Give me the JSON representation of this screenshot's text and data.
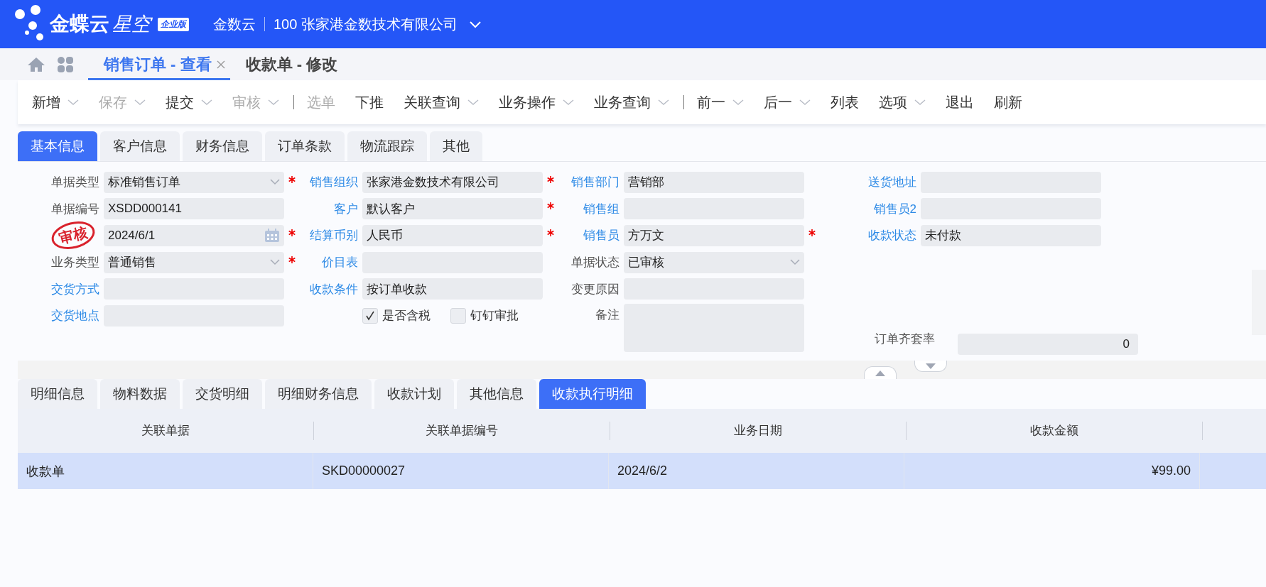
{
  "header": {
    "logo_main": "金蝶云",
    "logo_sub": "星空",
    "edition": "企业版",
    "tenant": "金数云",
    "company": "100 张家港金数技术有限公司"
  },
  "page_tabs": [
    {
      "label": "销售订单 - 查看",
      "selected": true,
      "closable": true
    },
    {
      "label": "收款单 - 修改",
      "selected": false,
      "closable": false
    }
  ],
  "toolbar": [
    {
      "kind": "button",
      "label": "新增",
      "dropdown": true,
      "disabled": false
    },
    {
      "kind": "button",
      "label": "保存",
      "dropdown": true,
      "disabled": true
    },
    {
      "kind": "button",
      "label": "提交",
      "dropdown": true,
      "disabled": false
    },
    {
      "kind": "button",
      "label": "审核",
      "dropdown": true,
      "disabled": true
    },
    {
      "kind": "separator"
    },
    {
      "kind": "button",
      "label": "选单",
      "dropdown": false,
      "disabled": true
    },
    {
      "kind": "button",
      "label": "下推",
      "dropdown": false,
      "disabled": false
    },
    {
      "kind": "button",
      "label": "关联查询",
      "dropdown": true,
      "disabled": false
    },
    {
      "kind": "button",
      "label": "业务操作",
      "dropdown": true,
      "disabled": false
    },
    {
      "kind": "button",
      "label": "业务查询",
      "dropdown": true,
      "disabled": false
    },
    {
      "kind": "separator"
    },
    {
      "kind": "button",
      "label": "前一",
      "dropdown": true,
      "disabled": false
    },
    {
      "kind": "button",
      "label": "后一",
      "dropdown": true,
      "disabled": false
    },
    {
      "kind": "button",
      "label": "列表",
      "dropdown": false,
      "disabled": false
    },
    {
      "kind": "button",
      "label": "选项",
      "dropdown": true,
      "disabled": false
    },
    {
      "kind": "button",
      "label": "退出",
      "dropdown": false,
      "disabled": false
    },
    {
      "kind": "button",
      "label": "刷新",
      "dropdown": false,
      "disabled": false
    }
  ],
  "form_tabs": [
    {
      "label": "基本信息",
      "selected": true
    },
    {
      "label": "客户信息",
      "selected": false
    },
    {
      "label": "财务信息",
      "selected": false
    },
    {
      "label": "订单条款",
      "selected": false
    },
    {
      "label": "物流跟踪",
      "selected": false
    },
    {
      "label": "其他",
      "selected": false
    }
  ],
  "form_columns": [
    [
      {
        "kind": "select",
        "label": "单据类型",
        "link": false,
        "value": "标准销售订单",
        "required": true
      },
      {
        "kind": "text",
        "label": "单据编号",
        "link": false,
        "value": "XSDD000141",
        "required": false
      },
      {
        "kind": "date",
        "stamp": "审核",
        "value": "2024/6/1",
        "required": true
      },
      {
        "kind": "select",
        "label": "业务类型",
        "link": false,
        "value": "普通销售",
        "required": true
      },
      {
        "kind": "text",
        "label": "交货方式",
        "link": true,
        "required": false
      },
      {
        "kind": "text",
        "label": "交货地点",
        "link": true,
        "required": false
      }
    ],
    [
      {
        "kind": "text",
        "label": "销售组织",
        "link": true,
        "value": "张家港金数技术有限公司",
        "required": true
      },
      {
        "kind": "text",
        "label": "客户",
        "link": true,
        "value": "默认客户",
        "required": true
      },
      {
        "kind": "text",
        "label": "结算币别",
        "link": true,
        "value": "人民币",
        "required": true
      },
      {
        "kind": "text",
        "label": "价目表",
        "link": true,
        "required": false
      },
      {
        "kind": "text",
        "label": "收款条件",
        "link": true,
        "value": "按订单收款",
        "required": false
      },
      {
        "kind": "checkboxes",
        "options": [
          {
            "label": "是否含税",
            "checked": true
          },
          {
            "label": "钉钉审批",
            "checked": false
          }
        ]
      }
    ],
    [
      {
        "kind": "text",
        "label": "销售部门",
        "link": true,
        "value": "营销部",
        "required": false
      },
      {
        "kind": "text",
        "label": "销售组",
        "link": true,
        "required": false
      },
      {
        "kind": "text",
        "label": "销售员",
        "link": true,
        "value": "方万文",
        "required": true
      },
      {
        "kind": "select",
        "label": "单据状态",
        "link": false,
        "value": "已审核",
        "required": false
      },
      {
        "kind": "text",
        "label": "变更原因",
        "link": false,
        "required": false
      },
      {
        "kind": "textarea",
        "label": "备注",
        "link": false,
        "required": false
      }
    ],
    [
      {
        "kind": "text",
        "label": "送货地址",
        "link": true,
        "required": false
      },
      {
        "kind": "text",
        "label": "销售员2",
        "link": true,
        "required": false
      },
      {
        "kind": "text",
        "label": "收款状态",
        "link": true,
        "value": "未付款",
        "required": false
      },
      {
        "kind": "number",
        "label": "订单齐套率",
        "link": false,
        "value": "0",
        "required": false
      }
    ]
  ],
  "detail_tabs": [
    {
      "label": "明细信息",
      "selected": false
    },
    {
      "label": "物料数据",
      "selected": false
    },
    {
      "label": "交货明细",
      "selected": false
    },
    {
      "label": "明细财务信息",
      "selected": false
    },
    {
      "label": "收款计划",
      "selected": false
    },
    {
      "label": "其他信息",
      "selected": false
    },
    {
      "label": "收款执行明细",
      "selected": true
    }
  ],
  "table": {
    "columns": [
      "关联单据",
      "关联单据编号",
      "业务日期",
      "收款金额"
    ],
    "rows": [
      {
        "selected": true,
        "cells": [
          "收款单",
          "SKD00000027",
          "2024/6/2",
          "¥99.00"
        ]
      }
    ]
  }
}
